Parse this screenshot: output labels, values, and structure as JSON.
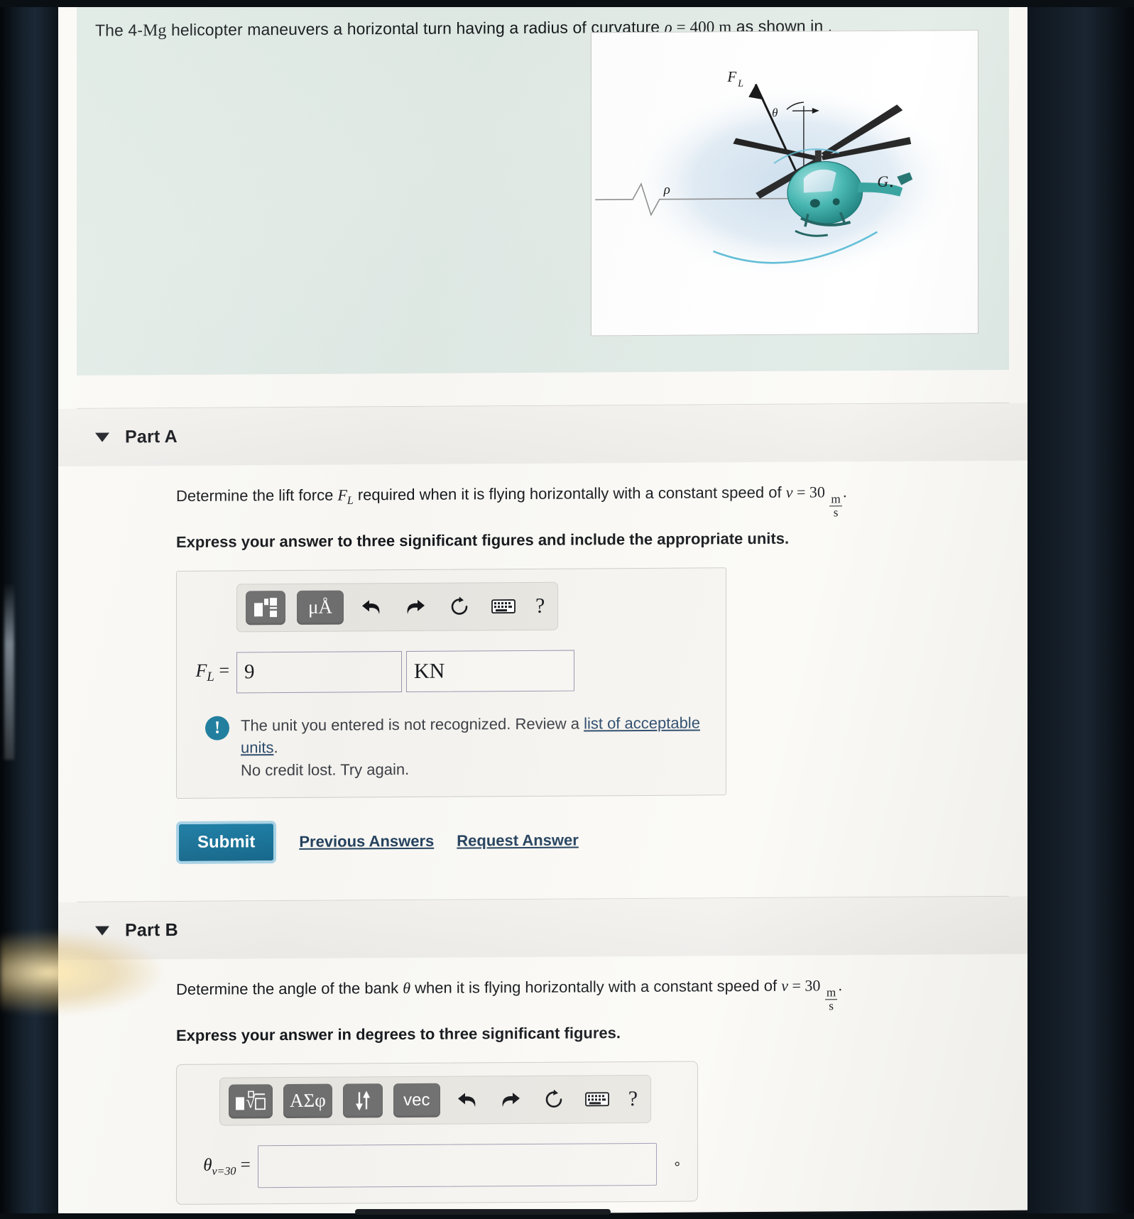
{
  "problem": {
    "text_part1": "The 4-",
    "mass_unit": "Mg",
    "text_part2": " helicopter maneuvers a horizontal turn having a radius of curvature ",
    "rho_symbol": "ρ",
    "rho_eq": " = ",
    "rho_value": "400",
    "rho_unit": "m",
    "text_part3": " as shown in ."
  },
  "figure": {
    "label_lift": "F",
    "label_lift_sub": "L",
    "label_theta": "θ",
    "label_rho": "ρ",
    "label_g": "G"
  },
  "parts": [
    {
      "id": "part-a",
      "title": "Part A",
      "caret": "▼",
      "question_pre": "Determine the lift force ",
      "question_var": "F",
      "question_var_sub": "L",
      "question_mid": " required when it is flying horizontally with a constant speed of ",
      "question_speed_var": "v",
      "question_speed_eq": " = ",
      "question_speed_value": "30",
      "question_speed_unit_num": "m",
      "question_speed_unit_den": "s",
      "question_end": ".",
      "instruction": "Express your answer to three significant figures and include the appropriate units.",
      "toolbar": [
        {
          "name": "template-box-icon",
          "type": "key",
          "label": ""
        },
        {
          "name": "units-micro-angstrom-button",
          "type": "key",
          "label": "μÅ"
        },
        {
          "name": "undo-icon",
          "type": "icon",
          "label": "undo"
        },
        {
          "name": "redo-icon",
          "type": "icon",
          "label": "redo"
        },
        {
          "name": "reset-icon",
          "type": "icon",
          "label": "reset"
        },
        {
          "name": "keyboard-icon",
          "type": "icon",
          "label": "keyboard"
        },
        {
          "name": "help-icon",
          "type": "help",
          "label": "?"
        }
      ],
      "answer_label_var": "F",
      "answer_label_sub": "L",
      "answer_label_eq": " =",
      "answer_value": "9",
      "answer_placeholder": "",
      "unit_value": "KN",
      "unit_placeholder": "",
      "feedback": {
        "icon": "!",
        "line1_pre": "The unit you entered is not recognized. Review a ",
        "line1_link": "list of acceptable units",
        "line1_post": ".",
        "line2": "No credit lost. Try again."
      },
      "submit_label": "Submit",
      "previous_answers_label": "Previous Answers",
      "request_answer_label": "Request Answer"
    },
    {
      "id": "part-b",
      "title": "Part B",
      "caret": "▼",
      "question_pre": "Determine the angle of the bank ",
      "question_var": "θ",
      "question_var_sub": "",
      "question_mid": " when it is flying horizontally with a constant speed of ",
      "question_speed_var": "v",
      "question_speed_eq": " = ",
      "question_speed_value": "30",
      "question_speed_unit_num": "m",
      "question_speed_unit_den": "s",
      "question_end": ".",
      "instruction": "Express your answer in degrees to three significant figures.",
      "toolbar": [
        {
          "name": "template-radical-icon",
          "type": "key",
          "label": ""
        },
        {
          "name": "greek-symbols-button",
          "type": "key",
          "label": "ΑΣφ"
        },
        {
          "name": "updown-arrows-button",
          "type": "key",
          "label": "⇵"
        },
        {
          "name": "vec-button",
          "type": "key",
          "label": "vec"
        },
        {
          "name": "undo-icon",
          "type": "icon",
          "label": "undo"
        },
        {
          "name": "redo-icon",
          "type": "icon",
          "label": "redo"
        },
        {
          "name": "reset-icon",
          "type": "icon",
          "label": "reset"
        },
        {
          "name": "keyboard-icon",
          "type": "icon",
          "label": "keyboard"
        },
        {
          "name": "help-icon",
          "type": "help",
          "label": "?"
        }
      ],
      "answer_label_var": "θ",
      "answer_label_sub": "v=30",
      "answer_label_eq": " =",
      "answer_value": "",
      "answer_placeholder": "",
      "degree_mark": "∘"
    }
  ],
  "colors": {
    "accent": "#1d7ea6",
    "link": "#24415e",
    "problem_bg": "#dfeae4",
    "feedback_icon": "#1d7d9e"
  }
}
